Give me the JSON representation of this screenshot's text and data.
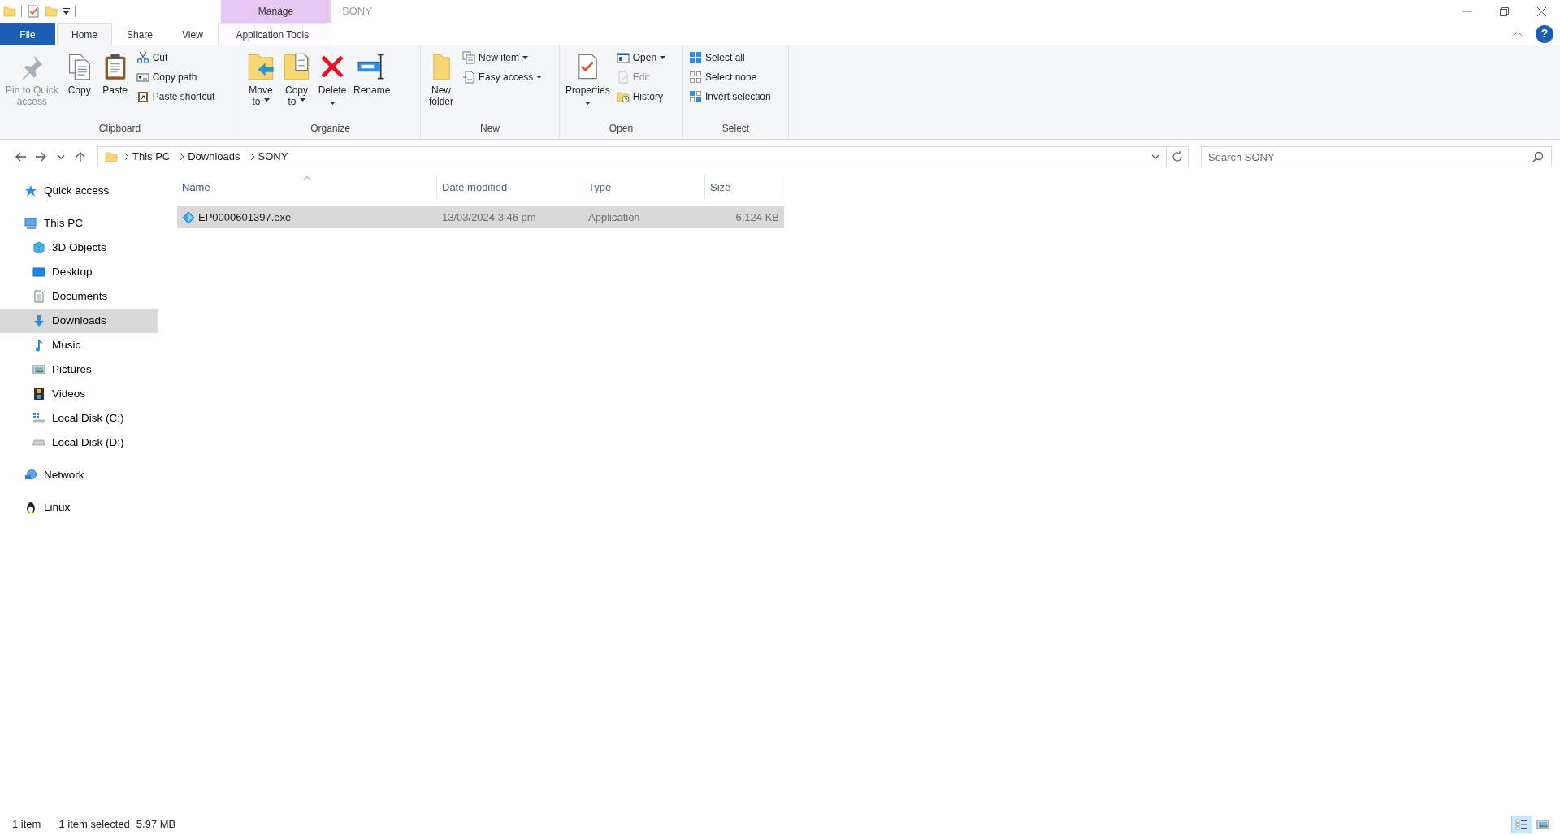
{
  "title_bar": {
    "contextual_group": "Manage",
    "title": "SONY"
  },
  "ribbon_tabs": [
    {
      "label": "File",
      "kind": "file",
      "selected": false
    },
    {
      "label": "Home",
      "kind": "standard",
      "selected": true
    },
    {
      "label": "Share",
      "kind": "standard",
      "selected": false
    },
    {
      "label": "View",
      "kind": "standard",
      "selected": false
    },
    {
      "label": "Application Tools",
      "kind": "contextual",
      "selected": false
    }
  ],
  "help_button": "?",
  "ribbon_groups": [
    {
      "label": "Clipboard",
      "items": [
        {
          "kind": "large",
          "label": "Pin to Quick access",
          "disabled": true,
          "dropdown": false
        },
        {
          "kind": "large",
          "label": "Copy",
          "disabled": false,
          "dropdown": false
        },
        {
          "kind": "large",
          "label": "Paste",
          "disabled": false,
          "dropdown": false
        },
        {
          "kind": "stack",
          "commands": [
            {
              "label": "Cut",
              "disabled": false,
              "dropdown": false
            },
            {
              "label": "Copy path",
              "disabled": false,
              "dropdown": false
            },
            {
              "label": "Paste shortcut",
              "disabled": false,
              "dropdown": false
            }
          ]
        }
      ]
    },
    {
      "label": "Organize",
      "items": [
        {
          "kind": "large",
          "label": "Move to",
          "disabled": false,
          "dropdown": true
        },
        {
          "kind": "large",
          "label": "Copy to",
          "disabled": false,
          "dropdown": true
        },
        {
          "kind": "large",
          "label": "Delete",
          "disabled": false,
          "dropdown": true
        },
        {
          "kind": "large",
          "label": "Rename",
          "disabled": false,
          "dropdown": false
        }
      ]
    },
    {
      "label": "New",
      "items": [
        {
          "kind": "large",
          "label": "New folder",
          "disabled": false,
          "dropdown": false
        },
        {
          "kind": "stack",
          "commands": [
            {
              "label": "New item",
              "disabled": false,
              "dropdown": true
            },
            {
              "label": "Easy access",
              "disabled": false,
              "dropdown": true
            }
          ]
        }
      ]
    },
    {
      "label": "Open",
      "items": [
        {
          "kind": "large",
          "label": "Properties",
          "disabled": false,
          "dropdown": true
        },
        {
          "kind": "stack",
          "commands": [
            {
              "label": "Open",
              "disabled": false,
              "dropdown": true
            },
            {
              "label": "Edit",
              "disabled": true,
              "dropdown": false
            },
            {
              "label": "History",
              "disabled": false,
              "dropdown": false
            }
          ]
        }
      ]
    },
    {
      "label": "Select",
      "items": [
        {
          "kind": "stack",
          "commands": [
            {
              "label": "Select all",
              "disabled": false,
              "dropdown": false
            },
            {
              "label": "Select none",
              "disabled": false,
              "dropdown": false
            },
            {
              "label": "Invert selection",
              "disabled": false,
              "dropdown": false
            }
          ]
        }
      ]
    }
  ],
  "address_bar": {
    "breadcrumbs": [
      "This PC",
      "Downloads",
      "SONY"
    ]
  },
  "search": {
    "placeholder": "Search SONY"
  },
  "navigation_pane": [
    {
      "label": "Quick access",
      "selected": false
    },
    {
      "label": "This PC",
      "selected": false,
      "children": [
        {
          "label": "3D Objects",
          "selected": false
        },
        {
          "label": "Desktop",
          "selected": false
        },
        {
          "label": "Documents",
          "selected": false
        },
        {
          "label": "Downloads",
          "selected": true
        },
        {
          "label": "Music",
          "selected": false
        },
        {
          "label": "Pictures",
          "selected": false
        },
        {
          "label": "Videos",
          "selected": false
        },
        {
          "label": "Local Disk (C:)",
          "selected": false
        },
        {
          "label": "Local Disk (D:)",
          "selected": false
        }
      ]
    },
    {
      "label": "Network",
      "selected": false
    },
    {
      "label": "Linux",
      "selected": false
    }
  ],
  "file_list": {
    "columns": [
      {
        "label": "Name",
        "sorted": true
      },
      {
        "label": "Date modified",
        "sorted": false
      },
      {
        "label": "Type",
        "sorted": false
      },
      {
        "label": "Size",
        "sorted": false
      }
    ],
    "rows": [
      {
        "name": "EP0000601397.exe",
        "date_modified": "13/03/2024 3:46 pm",
        "type": "Application",
        "size": "6,124 KB",
        "selected": true
      }
    ]
  },
  "status_bar": {
    "item_count": "1 item",
    "selection": "1 item selected",
    "selection_size": "5.97 MB"
  },
  "view_buttons": [
    {
      "selected": true
    },
    {
      "selected": false
    }
  ]
}
